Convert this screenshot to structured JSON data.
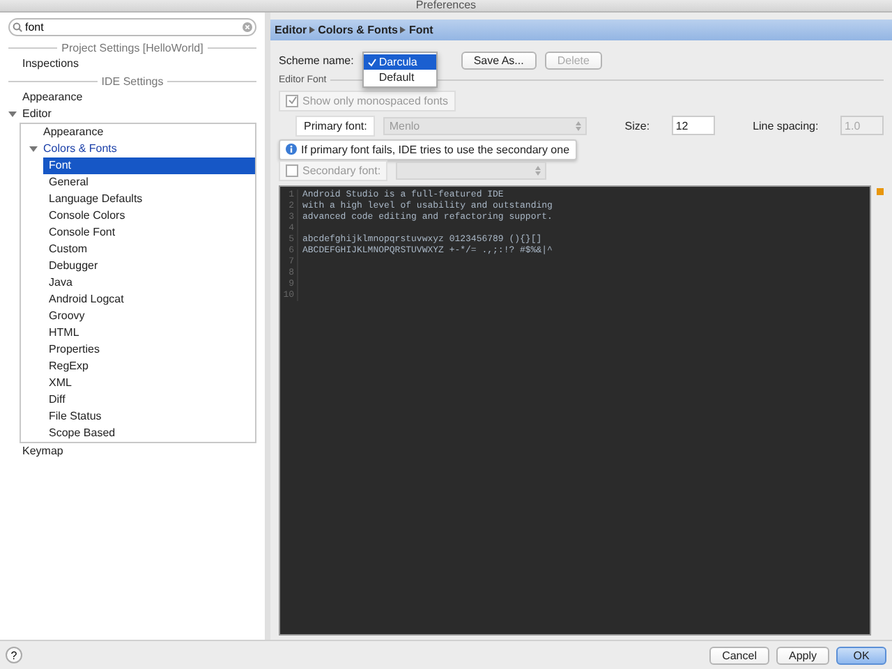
{
  "window": {
    "title": "Preferences"
  },
  "sidebar": {
    "search": {
      "value": "font"
    },
    "tree": [
      {
        "kind": "section",
        "label": "Project Settings [HelloWorld]"
      },
      {
        "kind": "item",
        "label": "Inspections"
      },
      {
        "kind": "section",
        "label": "IDE Settings"
      },
      {
        "kind": "item",
        "label": "Appearance"
      },
      {
        "kind": "item",
        "label": "Editor",
        "expanded": true,
        "children": [
          {
            "kind": "item",
            "label": "Appearance",
            "selected": false
          },
          {
            "kind": "item",
            "label": "Colors & Fonts",
            "expanded": true,
            "selected": false,
            "children": [
              {
                "kind": "item",
                "label": "Font",
                "selected": true
              },
              {
                "kind": "item",
                "label": "General",
                "selected": false
              },
              {
                "kind": "item",
                "label": "Language Defaults",
                "selected": false
              },
              {
                "kind": "item",
                "label": "Console Colors",
                "selected": false
              },
              {
                "kind": "item",
                "label": "Console Font",
                "selected": false
              },
              {
                "kind": "item",
                "label": "Custom",
                "selected": false
              },
              {
                "kind": "item",
                "label": "Debugger",
                "selected": false
              },
              {
                "kind": "item",
                "label": "Java",
                "selected": false
              },
              {
                "kind": "item",
                "label": "Android Logcat",
                "selected": false
              },
              {
                "kind": "item",
                "label": "Groovy",
                "selected": false
              },
              {
                "kind": "item",
                "label": "HTML",
                "selected": false
              },
              {
                "kind": "item",
                "label": "Properties",
                "selected": false
              },
              {
                "kind": "item",
                "label": "RegExp",
                "selected": false
              },
              {
                "kind": "item",
                "label": "XML",
                "selected": false
              },
              {
                "kind": "item",
                "label": "Diff",
                "selected": false
              },
              {
                "kind": "item",
                "label": "File Status",
                "selected": false
              },
              {
                "kind": "item",
                "label": "Scope Based",
                "selected": false
              }
            ]
          }
        ]
      },
      {
        "kind": "item",
        "label": "Keymap"
      }
    ]
  },
  "breadcrumb": [
    "Editor",
    "Colors & Fonts",
    "Font"
  ],
  "scheme": {
    "label": "Scheme name:",
    "options": [
      {
        "label": "Darcula",
        "selected": true
      },
      {
        "label": "Default",
        "selected": false
      }
    ],
    "buttons": [
      {
        "label": "Save As...",
        "disabled": false
      },
      {
        "label": "Delete",
        "disabled": true
      }
    ]
  },
  "editor_font": {
    "title": "Editor Font",
    "monospaced": {
      "label": "Show only monospaced fonts",
      "checked": true,
      "disabled": true
    },
    "primary_font": {
      "label": "Primary font:",
      "value": "Menlo"
    },
    "size": {
      "label": "Size:",
      "value": "12"
    },
    "line_spacing": {
      "label": "Line spacing:",
      "value": "1.0",
      "disabled": true
    },
    "tooltip": "If primary font fails, IDE tries to use the secondary one",
    "secondary_font": {
      "label": "Secondary font:",
      "checked": false
    }
  },
  "preview": [
    {
      "number": "1",
      "text": "Android Studio is a full-featured IDE"
    },
    {
      "number": "2",
      "text": "with a high level of usability and outstanding"
    },
    {
      "number": "3",
      "text": "advanced code editing and refactoring support."
    },
    {
      "number": "4"
    },
    {
      "number": "5",
      "text": "abcdefghijklmnopqrstuvwxyz 0123456789 (){}[]"
    },
    {
      "number": "6",
      "text": "ABCDEFGHIJKLMNOPQRSTUVWXYZ +-*/= .,;:!? #$%&|^"
    },
    {
      "number": "7"
    },
    {
      "number": "8"
    },
    {
      "number": "9"
    },
    {
      "number": "10"
    }
  ],
  "footer": {
    "help": "?",
    "buttons": [
      {
        "label": "Cancel",
        "default": false
      },
      {
        "label": "Apply",
        "default": false
      },
      {
        "label": "OK",
        "default": true
      }
    ]
  }
}
